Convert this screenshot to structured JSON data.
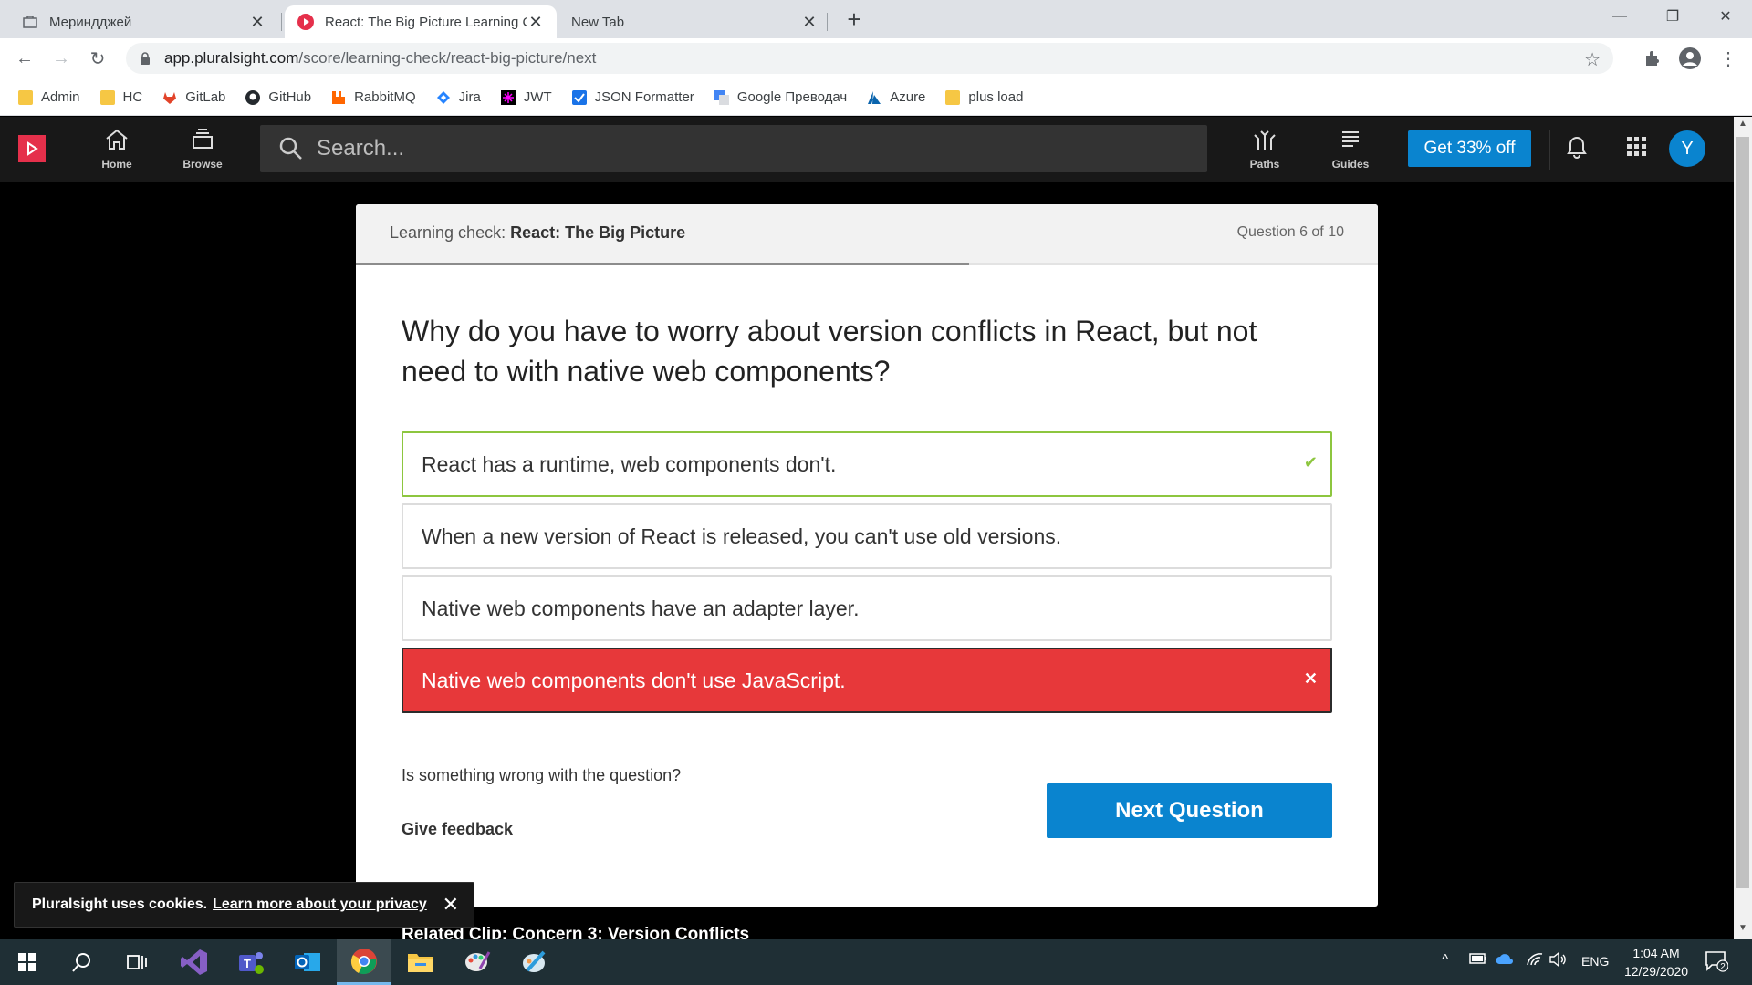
{
  "browser": {
    "tabs": [
      {
        "label": "Мериндджей",
        "active": false
      },
      {
        "label": "React: The Big Picture Learning C",
        "active": true
      },
      {
        "label": "New Tab",
        "active": false
      }
    ],
    "url_host": "app.pluralsight.com",
    "url_path": "/score/learning-check/react-big-picture/next",
    "bookmarks": [
      {
        "label": "Admin",
        "icon": "folder-icon"
      },
      {
        "label": "HC",
        "icon": "folder-icon"
      },
      {
        "label": "GitLab",
        "icon": "gitlab-icon"
      },
      {
        "label": "GitHub",
        "icon": "github-icon"
      },
      {
        "label": "RabbitMQ",
        "icon": "rabbitmq-icon"
      },
      {
        "label": "Jira",
        "icon": "jira-icon"
      },
      {
        "label": "JWT",
        "icon": "jwt-icon"
      },
      {
        "label": "JSON Formatter",
        "icon": "checkbox-icon"
      },
      {
        "label": "Google Преводач",
        "icon": "translate-icon"
      },
      {
        "label": "Azure",
        "icon": "azure-icon"
      },
      {
        "label": "plus load",
        "icon": "folder-icon"
      }
    ]
  },
  "app": {
    "nav": {
      "home": "Home",
      "browse": "Browse",
      "paths": "Paths",
      "guides": "Guides"
    },
    "search_placeholder": "Search...",
    "promo": "Get 33% off",
    "avatar_initial": "Y",
    "brand_color": "#e5304b",
    "accent_color": "#0a84cf"
  },
  "quiz": {
    "header_prefix": "Learning check:",
    "course": "React: The Big Picture",
    "counter": "Question 6 of 10",
    "progress": 0.6,
    "question": "Why do you have to worry about version conflicts in React, but not need to with native web components?",
    "answers": [
      {
        "text": "React has a runtime, web components don't.",
        "state": "correct"
      },
      {
        "text": "When a new version of React is released, you can't use old versions.",
        "state": "neutral"
      },
      {
        "text": "Native web components have an adapter layer.",
        "state": "neutral"
      },
      {
        "text": "Native web components don't use JavaScript.",
        "state": "wrong"
      }
    ],
    "wrong_question": "Is something wrong with the question?",
    "give_feedback": "Give feedback",
    "next_button": "Next Question",
    "related_clip": "Related Clip: Concern 3: Version Conflicts"
  },
  "cookie": {
    "text": "Pluralsight uses cookies.",
    "link": "Learn more about your privacy"
  },
  "taskbar": {
    "language": "ENG",
    "time": "1:04 AM",
    "date": "12/29/2020",
    "notifications": "2"
  }
}
